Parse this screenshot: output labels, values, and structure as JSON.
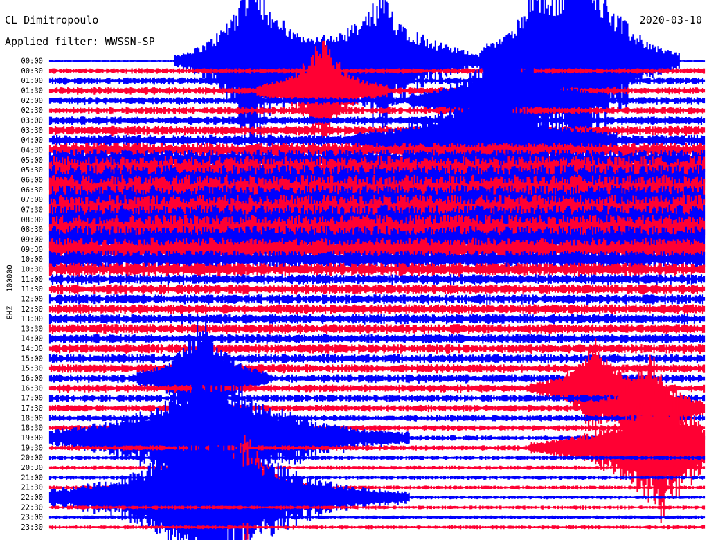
{
  "chart_data": {
    "type": "line",
    "title": "CL Dimitropoulo",
    "subtitle": "Applied filter: WWSSN-SP",
    "date": "2020-03-10",
    "ylabel": "EHZ - 100000",
    "xlabel": "",
    "row_labels": [
      "00:00",
      "00:30",
      "01:00",
      "01:30",
      "02:00",
      "02:30",
      "03:00",
      "03:30",
      "04:00",
      "04:30",
      "05:00",
      "05:30",
      "06:00",
      "06:30",
      "07:00",
      "07:30",
      "08:00",
      "08:30",
      "09:00",
      "09:30",
      "10:00",
      "10:30",
      "11:00",
      "11:30",
      "12:00",
      "12:30",
      "13:00",
      "13:30",
      "14:00",
      "14:30",
      "15:00",
      "15:30",
      "16:00",
      "16:30",
      "17:00",
      "17:30",
      "18:00",
      "18:30",
      "19:00",
      "19:30",
      "20:00",
      "20:30",
      "21:00",
      "21:30",
      "22:00",
      "22:30",
      "23:00",
      "23:30"
    ],
    "trace_colors": [
      "#0000ff",
      "#ff0033"
    ],
    "amplitude_profile": [
      0.25,
      0.55,
      0.7,
      0.7,
      0.7,
      0.7,
      0.8,
      0.9,
      1.1,
      1.5,
      2.2,
      2.8,
      3.0,
      3.0,
      3.0,
      3.0,
      3.0,
      3.0,
      2.7,
      2.3,
      1.8,
      1.3,
      1.0,
      0.95,
      0.95,
      0.95,
      0.95,
      0.95,
      0.9,
      0.9,
      0.9,
      0.85,
      0.85,
      0.75,
      0.7,
      0.65,
      0.6,
      0.55,
      0.5,
      0.5,
      0.45,
      0.4,
      0.4,
      0.4,
      0.35,
      0.35,
      0.35,
      0.35
    ],
    "spikes": [
      {
        "time": "00:00",
        "minute": 9.3,
        "amp": 22,
        "decay": 1.2
      },
      {
        "time": "00:00",
        "minute": 15.2,
        "amp": 14,
        "decay": 2.0
      },
      {
        "time": "00:00",
        "minute": 22.1,
        "amp": 10,
        "decay": 0.8
      },
      {
        "time": "00:00",
        "minute": 24.4,
        "amp": 30,
        "decay": 1.5
      },
      {
        "time": "01:30",
        "minute": 12.5,
        "amp": 12,
        "decay": 1.0
      },
      {
        "time": "02:00",
        "minute": 21.0,
        "amp": 16,
        "decay": 1.5
      },
      {
        "time": "04:00",
        "minute": 20.0,
        "amp": 14,
        "decay": 2.0
      },
      {
        "time": "16:00",
        "minute": 7.0,
        "amp": 14,
        "decay": 1.0
      },
      {
        "time": "16:30",
        "minute": 25.0,
        "amp": 10,
        "decay": 1.0
      },
      {
        "time": "17:30",
        "minute": 27.5,
        "amp": 12,
        "decay": 1.0
      },
      {
        "time": "19:00",
        "minute": 7.5,
        "amp": 16,
        "decay": 3.0
      },
      {
        "time": "19:30",
        "minute": 28.0,
        "amp": 14,
        "decay": 2.0
      },
      {
        "time": "21:30",
        "minute": 9.0,
        "amp": 12,
        "decay": 1.0
      },
      {
        "time": "22:00",
        "minute": 7.5,
        "amp": 18,
        "decay": 3.0
      }
    ]
  }
}
